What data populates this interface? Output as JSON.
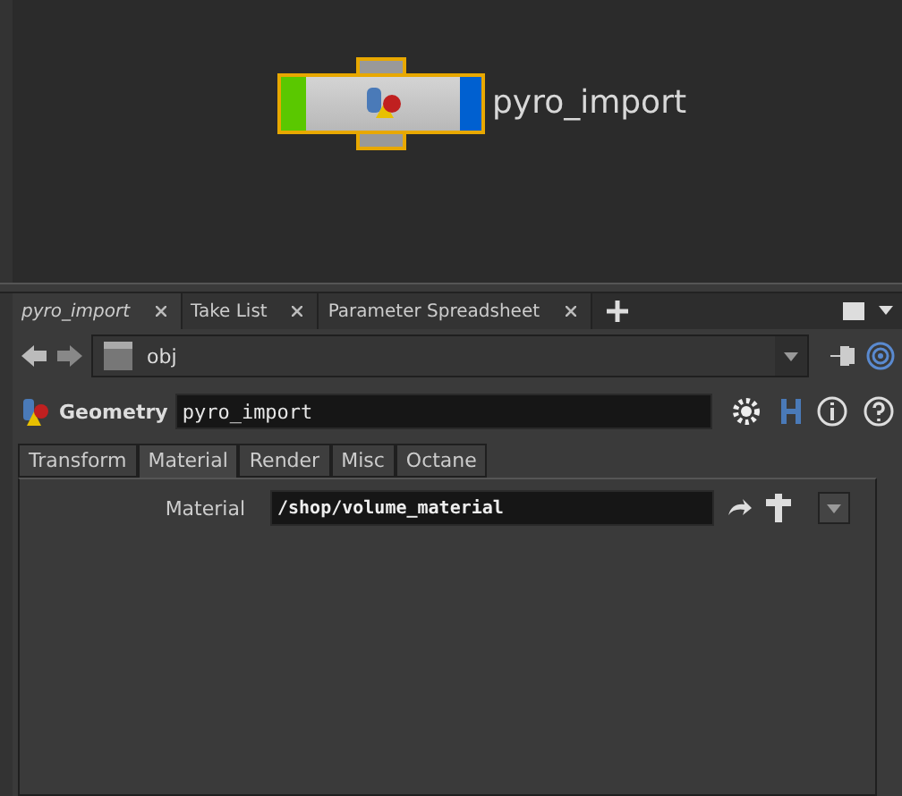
{
  "network": {
    "node": {
      "label": "pyro_import",
      "selected": true
    }
  },
  "pane_tabs": [
    {
      "label": "pyro_import",
      "selected": true
    },
    {
      "label": "Take List",
      "selected": false
    },
    {
      "label": "Parameter Spreadsheet",
      "selected": false
    }
  ],
  "path_bar": {
    "path": "obj"
  },
  "parameters": {
    "type": "Geometry",
    "name": "pyro_import",
    "tabs": [
      {
        "label": "Transform",
        "selected": false
      },
      {
        "label": "Material",
        "selected": true
      },
      {
        "label": "Render",
        "selected": false
      },
      {
        "label": "Misc",
        "selected": false
      },
      {
        "label": "Octane",
        "selected": false
      }
    ],
    "fields": [
      {
        "label": "Material",
        "value": "/shop/volume_material"
      }
    ]
  }
}
